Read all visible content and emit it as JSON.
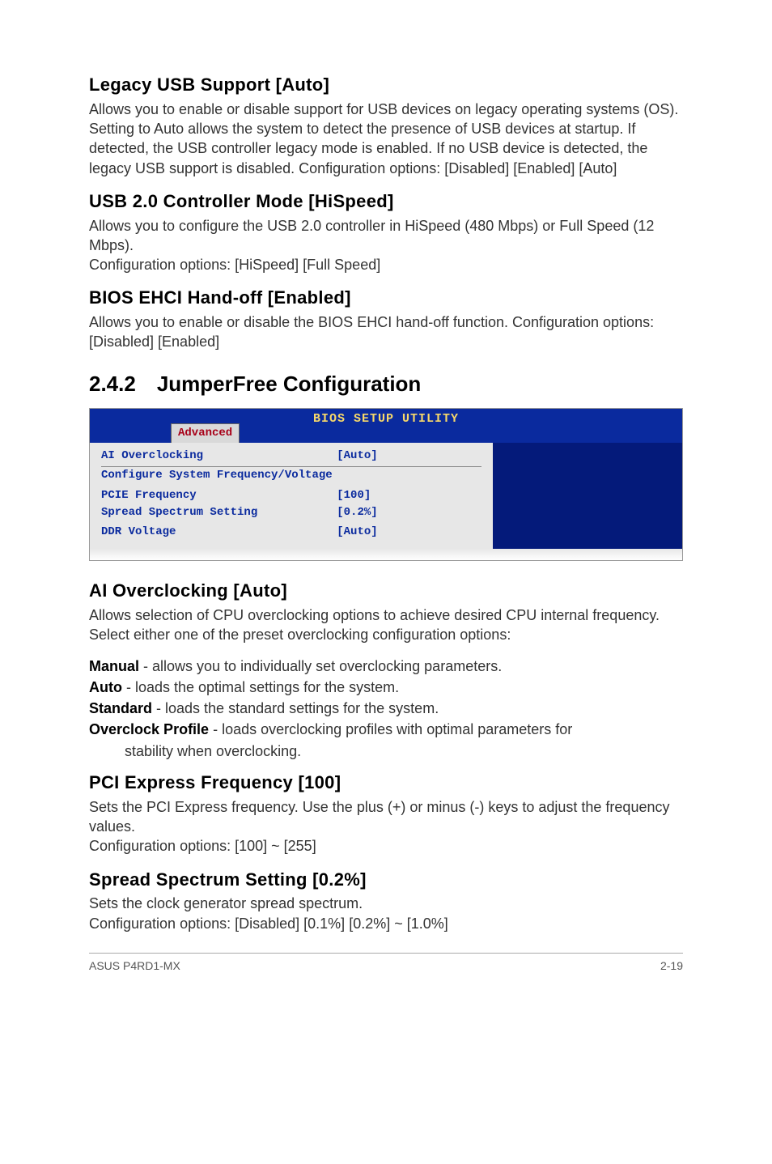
{
  "section_legacy_usb": {
    "heading": "Legacy USB Support [Auto]",
    "body": "Allows you to enable or disable support for USB devices on legacy operating systems (OS). Setting to Auto allows the system to detect the presence of USB devices at startup. If detected, the USB controller legacy mode is enabled. If no USB device is detected, the legacy USB support is disabled. Configuration options: [Disabled] [Enabled] [Auto]"
  },
  "section_usb20": {
    "heading": "USB 2.0 Controller Mode [HiSpeed]",
    "body1": "Allows you to configure the USB 2.0 controller in HiSpeed (480 Mbps) or Full Speed (12 Mbps).",
    "body2": "Configuration options: [HiSpeed] [Full Speed]"
  },
  "section_ehci": {
    "heading": "BIOS EHCI Hand-off [Enabled]",
    "body": "Allows you to enable or disable the BIOS EHCI hand-off function. Configuration options: [Disabled] [Enabled]"
  },
  "section_jumperfree": {
    "heading": "2.4.2 JumperFree Configuration"
  },
  "bios": {
    "title": "BIOS SETUP UTILITY",
    "tab": "Advanced",
    "rows": {
      "ai_over_label": "AI Overclocking",
      "ai_over_val": "[Auto]",
      "divider": "Configure System Frequency/Voltage",
      "pcie_label": "PCIE Frequency",
      "pcie_val": "[100]",
      "spread_label": "Spread Spectrum Setting",
      "spread_val": "[0.2%]",
      "ddr_label": "DDR Voltage",
      "ddr_val": "[Auto]"
    }
  },
  "section_ai_over": {
    "heading": "AI Overclocking [Auto]",
    "body": "Allows selection of CPU overclocking options to achieve desired CPU internal frequency. Select either one of the preset overclocking configuration options:",
    "defs": {
      "manual_term": "Manual",
      "manual_text": " - allows you to individually set overclocking parameters.",
      "auto_term": "Auto",
      "auto_text": " - loads the optimal settings for the system.",
      "standard_term": "Standard",
      "standard_text": " - loads the standard settings for the system.",
      "profile_term": "Overclock Profile",
      "profile_text": " - loads overclocking profiles with optimal parameters for",
      "profile_cont": "stability when overclocking."
    }
  },
  "section_pci": {
    "heading": "PCI Express Frequency [100]",
    "body1": "Sets the PCI Express frequency. Use the plus (+) or minus (-) keys to adjust the frequency values.",
    "body2": "Configuration options: [100] ~ [255]"
  },
  "section_spread": {
    "heading": "Spread Spectrum Setting [0.2%]",
    "body1": "Sets the clock generator spread spectrum.",
    "body2": "Configuration options: [Disabled] [0.1%] [0.2%] ~ [1.0%]"
  },
  "footer": {
    "left": "ASUS P4RD1-MX",
    "right": "2-19"
  }
}
